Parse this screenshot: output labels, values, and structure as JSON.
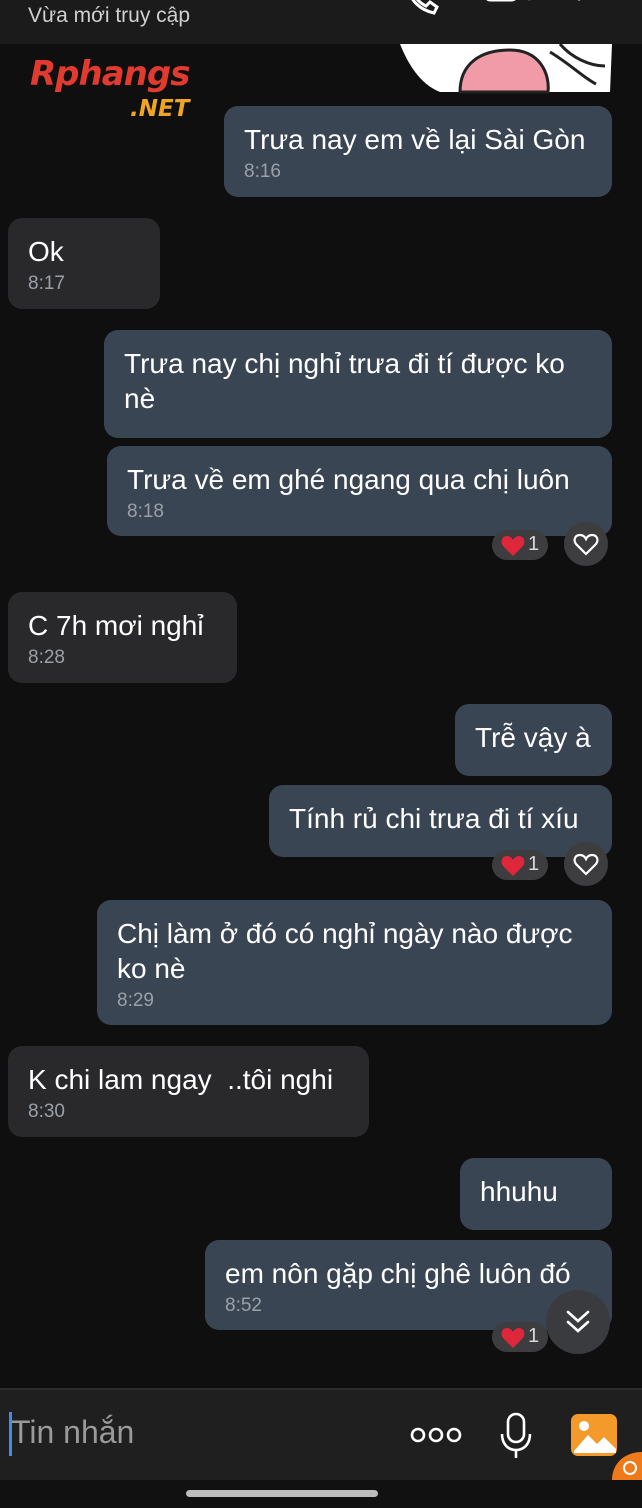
{
  "header": {
    "status": "Vừa mới truy cập"
  },
  "watermark": {
    "text": "Rphangs",
    "suffix": ".NET"
  },
  "messages": [
    {
      "text": "Trưa nay em về lại Sài Gòn",
      "time": "8:16"
    },
    {
      "text": "Ok",
      "time": "8:17"
    },
    {
      "text": "Trưa nay chị nghỉ trưa đi tí được ko nè"
    },
    {
      "text": "Trưa về em ghé ngang qua chị luôn",
      "time": "8:18",
      "reaction_count": "1"
    },
    {
      "text": "C 7h mơi nghỉ",
      "time": "8:28"
    },
    {
      "text": "Trễ vậy à"
    },
    {
      "text": "Tính rủ chi trưa đi tí xíu",
      "reaction_count": "1"
    },
    {
      "text": "Chị làm ở đó có nghỉ ngày nào được ko nè",
      "time": "8:29"
    },
    {
      "text": "K chi lam ngay  ..tôi nghi",
      "time": "8:30"
    },
    {
      "text": "hhuhu"
    },
    {
      "text": "em nôn gặp chị ghê luôn đó",
      "time": "8:52",
      "reaction_count": "1"
    }
  ],
  "composer": {
    "placeholder": "Tin nhắn"
  },
  "icons": {
    "phone": "phone-icon",
    "video": "video-icon",
    "menu": "menu-icon",
    "heart": "heart-icon",
    "like": "heart-outline-icon",
    "scroll": "chevron-down-double-icon",
    "more": "more-dots-icon",
    "mic": "microphone-icon",
    "image": "image-icon"
  },
  "colors": {
    "outgoing_bubble": "#3a4553",
    "incoming_bubble": "#29292b",
    "heart": "#e0263a",
    "accent_caret": "#3e8ef0",
    "image_icon": "#f39a2b"
  }
}
